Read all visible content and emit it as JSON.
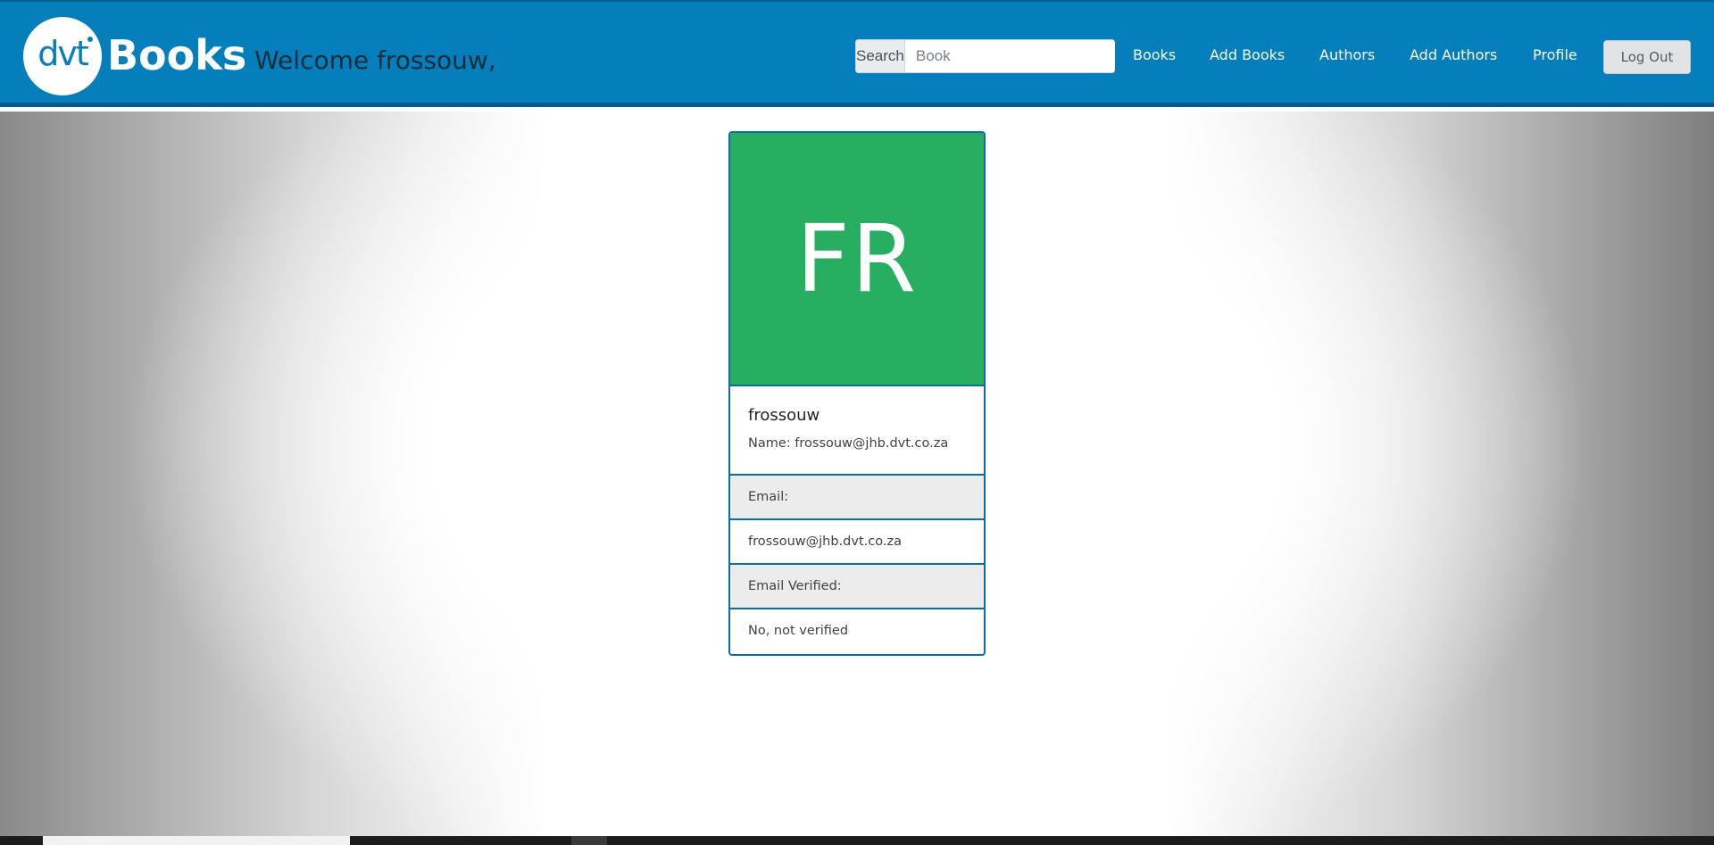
{
  "header": {
    "logo_text": "dvt",
    "brand": "Books",
    "welcome": "Welcome frossouw,"
  },
  "search": {
    "label": "Search",
    "placeholder": "Book",
    "value": ""
  },
  "nav": {
    "books": "Books",
    "add_books": "Add Books",
    "authors": "Authors",
    "add_authors": "Add Authors",
    "profile": "Profile",
    "logout": "Log Out"
  },
  "profile": {
    "avatar_initials": "FR",
    "username": "frossouw",
    "name_line": "Name: frossouw@jhb.dvt.co.za",
    "email_label": "Email:",
    "email_value": "frossouw@jhb.dvt.co.za",
    "verified_label": "Email Verified:",
    "verified_value": "No, not verified"
  },
  "colors": {
    "navbar": "#047fbc",
    "avatar": "#27ae60",
    "card_border": "#0a6ea8"
  }
}
